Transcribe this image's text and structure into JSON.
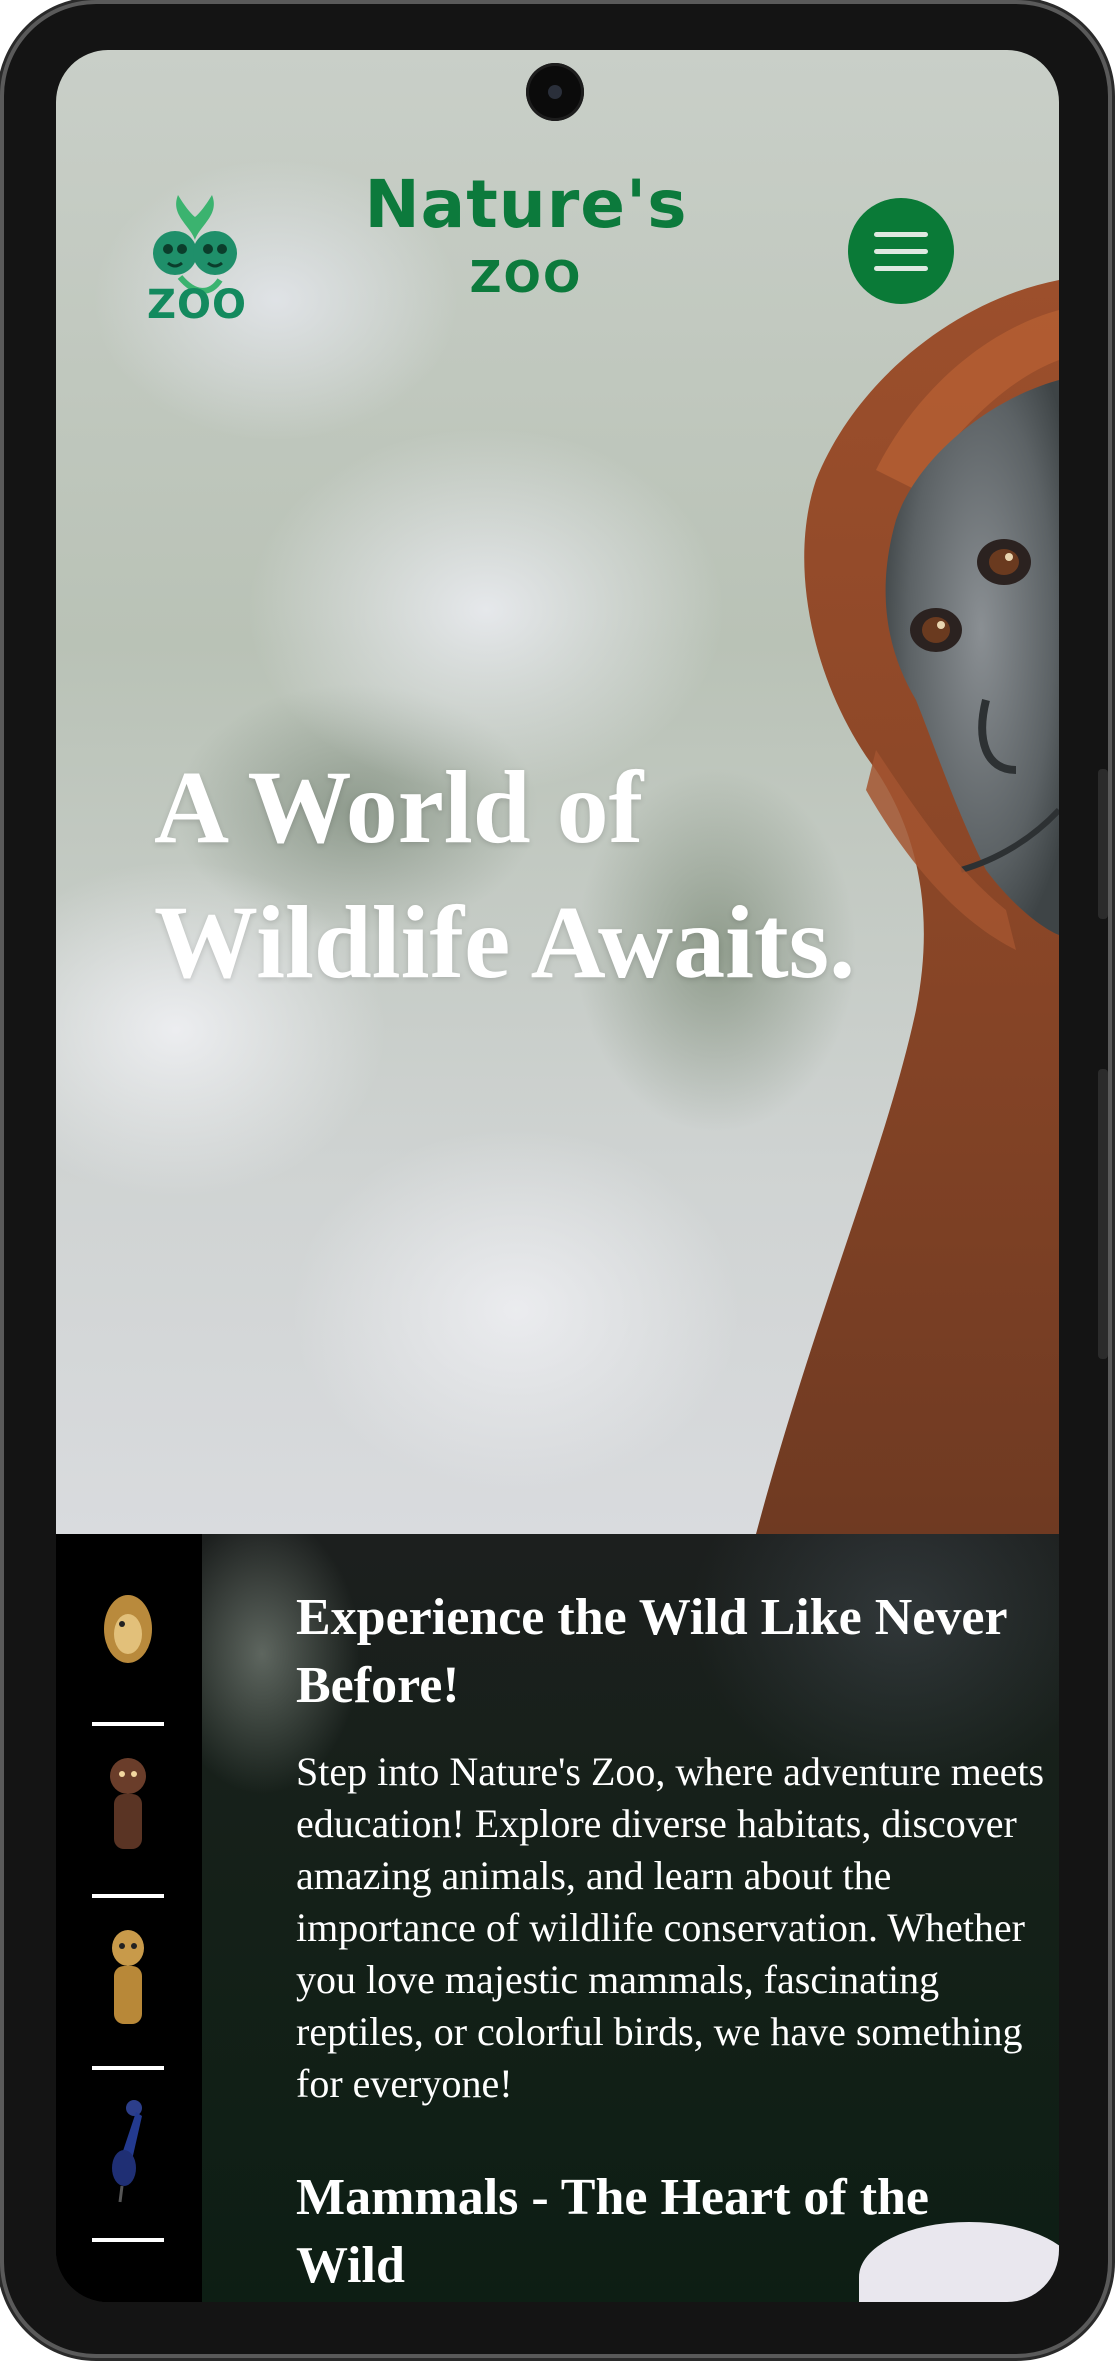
{
  "header": {
    "logo_text": "ZOO",
    "brand_line1": "Nature's",
    "brand_line2": "ZOO",
    "menu_icon": "hamburger-menu-icon",
    "brand_color": "#0c7a3c",
    "menu_button_color": "#0a7a37"
  },
  "hero": {
    "title_line1": "A World of",
    "title_line2": "Wildlife Awaits.",
    "image": "orangutan"
  },
  "sidebar_thumbnails": [
    {
      "icon": "hedgehog-thumbnail"
    },
    {
      "icon": "monkey-thumbnail"
    },
    {
      "icon": "lemur-thumbnail"
    },
    {
      "icon": "bird-thumbnail"
    }
  ],
  "intro": {
    "title": "Experience the Wild Like Never Before!",
    "body": "Step into Nature's Zoo, where adventure meets education! Explore diverse habitats, discover amazing animals, and learn about the importance of wildlife conservation. Whether you love majestic mammals, fascinating reptiles, or colorful birds, we have something for everyone!"
  },
  "mammals": {
    "title": "Mammals - The Heart of the Wild"
  }
}
